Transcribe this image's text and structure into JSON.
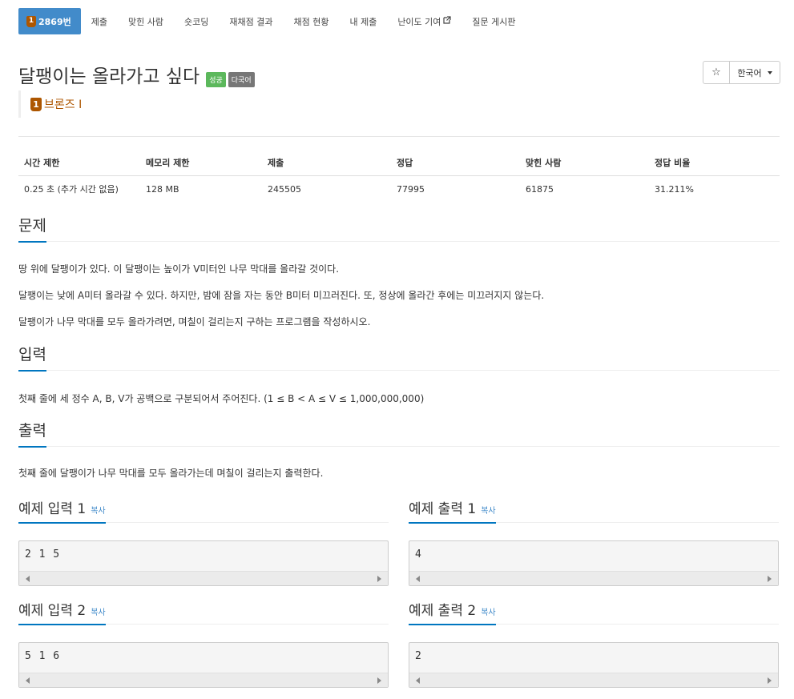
{
  "tabs": [
    {
      "label": "2869번",
      "tier": "1",
      "active": true
    },
    {
      "label": "제출"
    },
    {
      "label": "맞힌 사람"
    },
    {
      "label": "숏코딩"
    },
    {
      "label": "재채점 결과"
    },
    {
      "label": "채점 현황"
    },
    {
      "label": "내 제출"
    },
    {
      "label": "난이도 기여",
      "external": true
    },
    {
      "label": "질문 게시판"
    }
  ],
  "problem": {
    "title": "달팽이는 올라가고 싶다",
    "badges": {
      "success": "성공",
      "multi": "다국어"
    },
    "tier_level": "1",
    "tier_name": "브론즈 I"
  },
  "actions": {
    "star": "☆",
    "language": "한국어"
  },
  "info": {
    "headers": [
      "시간 제한",
      "메모리 제한",
      "제출",
      "정답",
      "맞힌 사람",
      "정답 비율"
    ],
    "values": [
      "0.25 초 (추가 시간 없음)",
      "128 MB",
      "245505",
      "77995",
      "61875",
      "31.211%"
    ]
  },
  "sections": {
    "problem": {
      "title": "문제",
      "paragraphs": [
        "땅 위에 달팽이가 있다. 이 달팽이는 높이가 V미터인 나무 막대를 올라갈 것이다.",
        "달팽이는 낮에 A미터 올라갈 수 있다. 하지만, 밤에 잠을 자는 동안 B미터 미끄러진다. 또, 정상에 올라간 후에는 미끄러지지 않는다.",
        "달팽이가 나무 막대를 모두 올라가려면, 며칠이 걸리는지 구하는 프로그램을 작성하시오."
      ]
    },
    "input": {
      "title": "입력",
      "text": "첫째 줄에 세 정수 A, B, V가 공백으로 구분되어서 주어진다. (1 ≤ B < A ≤ V ≤ 1,000,000,000)"
    },
    "output": {
      "title": "출력",
      "text": "첫째 줄에 달팽이가 나무 막대를 모두 올라가는데 며칠이 걸리는지 출력한다."
    }
  },
  "samples": {
    "copy_label": "복사",
    "in1": {
      "title": "예제 입력 1",
      "value": "2 1 5"
    },
    "out1": {
      "title": "예제 출력 1",
      "value": "4"
    },
    "in2": {
      "title": "예제 입력 2",
      "value": "5 1 6"
    },
    "out2": {
      "title": "예제 출력 2",
      "value": "2"
    }
  },
  "colors": {
    "accent": "#428bca",
    "bronze": "#ad5600",
    "success": "#5cb85c",
    "muted": "#777777"
  }
}
